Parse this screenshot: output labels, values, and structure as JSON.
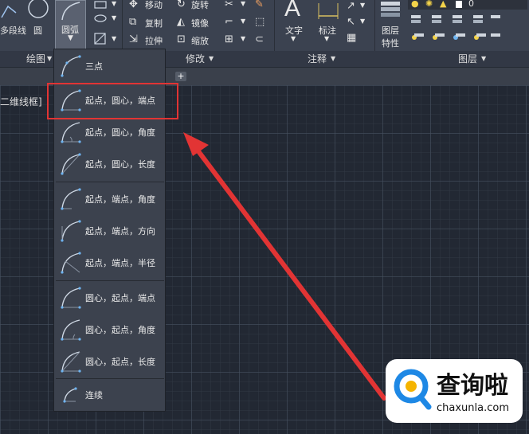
{
  "ribbon": {
    "draw_panel": {
      "polyline_label": "多段线",
      "circle_label": "圆",
      "arc_label": "圆弧",
      "title": "绘图"
    },
    "modify_panel": {
      "move": "移动",
      "rotate": "旋转",
      "copy": "复制",
      "mirror": "镜像",
      "stretch": "拉伸",
      "scale": "缩放",
      "title": "修改"
    },
    "annotation_panel": {
      "text": "文字",
      "dimension": "标注",
      "title": "注释"
    },
    "layers_panel": {
      "layer_props_line1": "图层",
      "layer_props_line2": "特性",
      "current_layer": "0",
      "title": "图层"
    }
  },
  "viewport": {
    "view_label": "二维线框]"
  },
  "arc_menu": {
    "items": [
      {
        "label": "三点"
      },
      {
        "label": "起点，圆心，端点"
      },
      {
        "label": "起点，圆心，角度"
      },
      {
        "label": "起点，圆心，长度"
      },
      {
        "label": "起点，端点，角度"
      },
      {
        "label": "起点，端点，方向"
      },
      {
        "label": "起点，端点，半径"
      },
      {
        "label": "圆心，起点，端点"
      },
      {
        "label": "圆心，起点，角度"
      },
      {
        "label": "圆心，起点，长度"
      },
      {
        "label": "连续"
      }
    ]
  },
  "watermark": {
    "name": "查询啦",
    "url": "chaxunla.com"
  },
  "colors": {
    "highlight": "#e23434",
    "arrow": "#e23434",
    "accent": "#1e88e5"
  }
}
